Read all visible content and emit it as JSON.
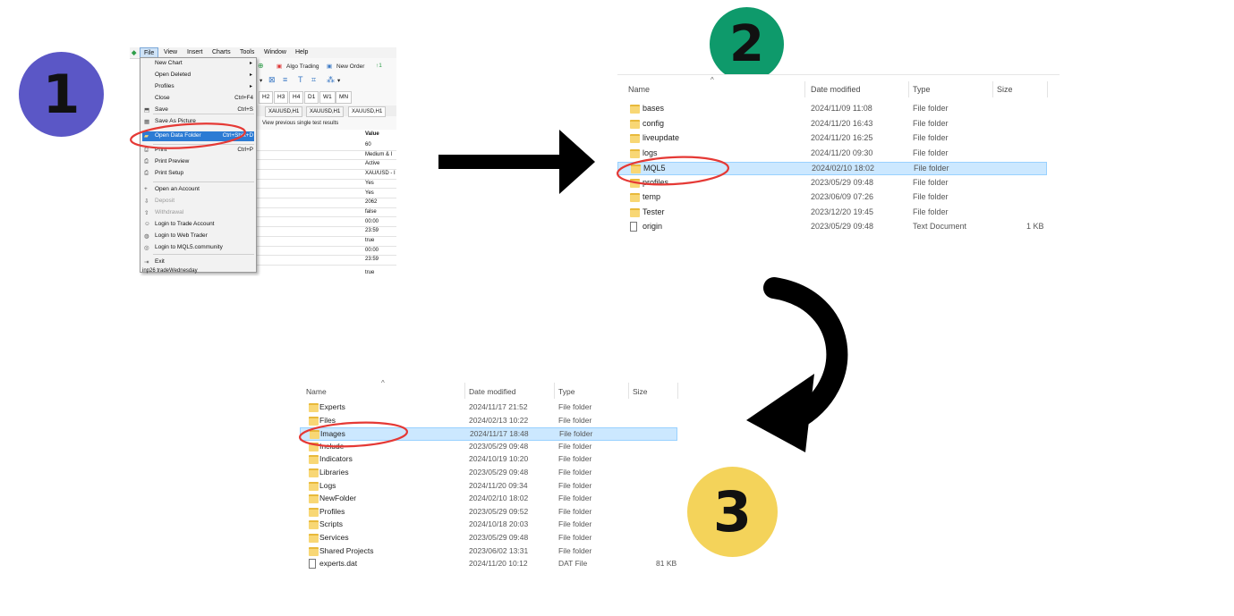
{
  "steps": [
    "1",
    "2",
    "3"
  ],
  "colors": {
    "step1": "#5b57c6",
    "step2": "#0e9a6b",
    "step3": "#f4d35a",
    "annotation": "#e53935",
    "selection": "#cce8ff",
    "folder": "#f8d775"
  },
  "panel1": {
    "menubar": [
      "File",
      "View",
      "Insert",
      "Charts",
      "Tools",
      "Window",
      "Help"
    ],
    "toolbar": {
      "algo_trading": "Algo Trading",
      "new_order": "New Order"
    },
    "timeframes": [
      "H2",
      "H3",
      "H4",
      "D1",
      "W1",
      "MN"
    ],
    "chart_tabs": [
      "XAUUSD,H1",
      "XAUUSD,H1",
      "XAUUSD,H1"
    ],
    "tester_tab": "View previous single test results",
    "value_header": "Value",
    "values": [
      "60",
      "Medium & I",
      "Active",
      "XAU/USD - I",
      "Yes",
      "Yes",
      "2062",
      "false",
      "00:00",
      "23:59",
      "true",
      "00:00",
      "23:59"
    ],
    "bottom_param": "inp26 tradeWednesday",
    "bottom_value": "true",
    "file_menu": [
      {
        "label": "New Chart",
        "shortcut": "",
        "submenu": true
      },
      {
        "label": "Open Deleted",
        "shortcut": "",
        "submenu": true
      },
      {
        "label": "Profiles",
        "shortcut": "",
        "submenu": true
      },
      {
        "label": "Close",
        "shortcut": "Ctrl+F4"
      },
      {
        "label": "Save",
        "shortcut": "Ctrl+S"
      },
      {
        "label": "Save As Picture",
        "shortcut": ""
      },
      {
        "label": "Open Data Folder",
        "shortcut": "Ctrl+Shift+D",
        "highlighted": true
      },
      {
        "label": "Print",
        "shortcut": "Ctrl+P"
      },
      {
        "label": "Print Preview",
        "shortcut": ""
      },
      {
        "label": "Print Setup",
        "shortcut": ""
      },
      {
        "label": "Open an Account",
        "shortcut": ""
      },
      {
        "label": "Deposit",
        "shortcut": "",
        "disabled": true
      },
      {
        "label": "Withdrawal",
        "shortcut": "",
        "disabled": true
      },
      {
        "label": "Login to Trade Account",
        "shortcut": ""
      },
      {
        "label": "Login to Web Trader",
        "shortcut": ""
      },
      {
        "label": "Login to MQL5.community",
        "shortcut": ""
      },
      {
        "label": "Exit",
        "shortcut": ""
      }
    ]
  },
  "panel2": {
    "columns": {
      "name": "Name",
      "date": "Date modified",
      "type": "Type",
      "size": "Size"
    },
    "rows": [
      {
        "name": "bases",
        "date": "2024/11/09 11:08",
        "type": "File folder",
        "size": "",
        "icon": "folder"
      },
      {
        "name": "config",
        "date": "2024/11/20 16:43",
        "type": "File folder",
        "size": "",
        "icon": "folder"
      },
      {
        "name": "liveupdate",
        "date": "2024/11/20 16:25",
        "type": "File folder",
        "size": "",
        "icon": "folder"
      },
      {
        "name": "logs",
        "date": "2024/11/20 09:30",
        "type": "File folder",
        "size": "",
        "icon": "folder"
      },
      {
        "name": "MQL5",
        "date": "2024/02/10 18:02",
        "type": "File folder",
        "size": "",
        "icon": "folder",
        "selected": true
      },
      {
        "name": "profiles",
        "date": "2023/05/29 09:48",
        "type": "File folder",
        "size": "",
        "icon": "folder"
      },
      {
        "name": "temp",
        "date": "2023/06/09 07:26",
        "type": "File folder",
        "size": "",
        "icon": "folder"
      },
      {
        "name": "Tester",
        "date": "2023/12/20 19:45",
        "type": "File folder",
        "size": "",
        "icon": "folder"
      },
      {
        "name": "origin",
        "date": "2023/05/29 09:48",
        "type": "Text Document",
        "size": "1 KB",
        "icon": "document"
      }
    ]
  },
  "panel3": {
    "columns": {
      "name": "Name",
      "date": "Date modified",
      "type": "Type",
      "size": "Size"
    },
    "rows": [
      {
        "name": "Experts",
        "date": "2024/11/17 21:52",
        "type": "File folder",
        "size": "",
        "icon": "folder"
      },
      {
        "name": "Files",
        "date": "2024/02/13 10:22",
        "type": "File folder",
        "size": "",
        "icon": "folder"
      },
      {
        "name": "Images",
        "date": "2024/11/17 18:48",
        "type": "File folder",
        "size": "",
        "icon": "folder",
        "selected": true
      },
      {
        "name": "Include",
        "date": "2023/05/29 09:48",
        "type": "File folder",
        "size": "",
        "icon": "folder"
      },
      {
        "name": "Indicators",
        "date": "2024/10/19 10:20",
        "type": "File folder",
        "size": "",
        "icon": "folder"
      },
      {
        "name": "Libraries",
        "date": "2023/05/29 09:48",
        "type": "File folder",
        "size": "",
        "icon": "folder"
      },
      {
        "name": "Logs",
        "date": "2024/11/20 09:34",
        "type": "File folder",
        "size": "",
        "icon": "folder"
      },
      {
        "name": "NewFolder",
        "date": "2024/02/10 18:02",
        "type": "File folder",
        "size": "",
        "icon": "folder"
      },
      {
        "name": "Profiles",
        "date": "2023/05/29 09:52",
        "type": "File folder",
        "size": "",
        "icon": "folder"
      },
      {
        "name": "Scripts",
        "date": "2024/10/18 20:03",
        "type": "File folder",
        "size": "",
        "icon": "folder"
      },
      {
        "name": "Services",
        "date": "2023/05/29 09:48",
        "type": "File folder",
        "size": "",
        "icon": "folder"
      },
      {
        "name": "Shared Projects",
        "date": "2023/06/02 13:31",
        "type": "File folder",
        "size": "",
        "icon": "folder"
      },
      {
        "name": "experts.dat",
        "date": "2024/11/20 10:12",
        "type": "DAT File",
        "size": "81 KB",
        "icon": "document"
      }
    ]
  }
}
